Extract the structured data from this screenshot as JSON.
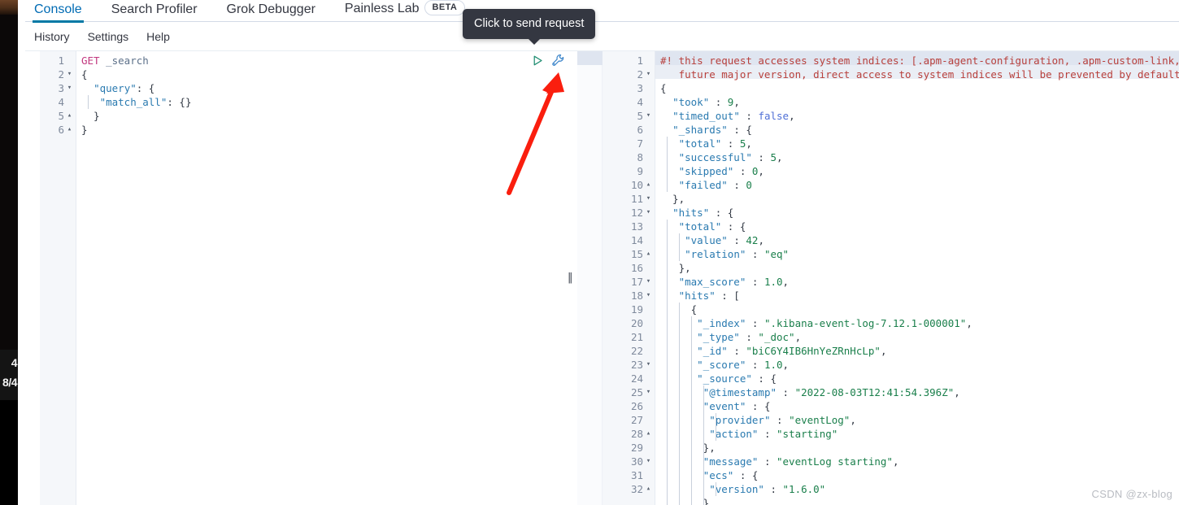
{
  "overlay": {
    "partial_line_1": "4",
    "partial_line_2": "8/4"
  },
  "tabs": [
    {
      "label": "Console",
      "active": true
    },
    {
      "label": "Search Profiler",
      "active": false
    },
    {
      "label": "Grok Debugger",
      "active": false
    },
    {
      "label": "Painless Lab",
      "active": false,
      "badge": "BETA"
    }
  ],
  "submenu": [
    {
      "label": "History"
    },
    {
      "label": "Settings"
    },
    {
      "label": "Help"
    }
  ],
  "tooltip": {
    "text": "Click to send request"
  },
  "actions": {
    "send_icon": "play-triangle-icon",
    "wrench_icon": "wrench-icon"
  },
  "divider": {
    "grip": "‖"
  },
  "request_editor": {
    "lines": [
      {
        "n": "1",
        "fold": "",
        "indent": 0,
        "tokens": [
          {
            "t": "GET",
            "c": "t-method"
          },
          {
            "t": " ",
            "c": "t-punc"
          },
          {
            "t": "_search",
            "c": "t-url"
          }
        ]
      },
      {
        "n": "2",
        "fold": "▾",
        "indent": 0,
        "tokens": [
          {
            "t": "{",
            "c": "t-punc"
          }
        ]
      },
      {
        "n": "3",
        "fold": "▾",
        "indent": 0,
        "tokens": [
          {
            "t": "  ",
            "c": "t-punc"
          },
          {
            "t": "\"query\"",
            "c": "t-key"
          },
          {
            "t": ": {",
            "c": "t-punc"
          }
        ]
      },
      {
        "n": "4",
        "fold": "",
        "indent": 1,
        "tokens": [
          {
            "t": "   ",
            "c": "t-punc"
          },
          {
            "t": "\"match_all\"",
            "c": "t-key"
          },
          {
            "t": ": {}",
            "c": "t-punc"
          }
        ]
      },
      {
        "n": "5",
        "fold": "▴",
        "indent": 0,
        "tokens": [
          {
            "t": "  }",
            "c": "t-punc"
          }
        ]
      },
      {
        "n": "6",
        "fold": "▴",
        "indent": 0,
        "tokens": [
          {
            "t": "}",
            "c": "t-punc"
          }
        ]
      }
    ]
  },
  "response_editor": {
    "lines": [
      {
        "n": "1",
        "fold": "",
        "indent": 0,
        "tokens": [
          {
            "t": "#! this request accesses system indices: [.apm-agent-configuration, .apm-custom-link, .k",
            "c": "t-warn"
          }
        ]
      },
      {
        "n": "",
        "fold": "",
        "indent": 0,
        "tokens": [
          {
            "t": "   future major version, direct access to system indices will be prevented by default",
            "c": "t-warn"
          }
        ]
      },
      {
        "n": "2",
        "fold": "▾",
        "indent": 0,
        "tokens": [
          {
            "t": "{",
            "c": "t-punc"
          }
        ]
      },
      {
        "n": "3",
        "fold": "",
        "indent": 0,
        "tokens": [
          {
            "t": "  ",
            "c": "t-punc"
          },
          {
            "t": "\"took\"",
            "c": "t-key"
          },
          {
            "t": " : ",
            "c": "t-punc"
          },
          {
            "t": "9",
            "c": "t-num"
          },
          {
            "t": ",",
            "c": "t-punc"
          }
        ]
      },
      {
        "n": "4",
        "fold": "",
        "indent": 0,
        "tokens": [
          {
            "t": "  ",
            "c": "t-punc"
          },
          {
            "t": "\"timed_out\"",
            "c": "t-key"
          },
          {
            "t": " : ",
            "c": "t-punc"
          },
          {
            "t": "false",
            "c": "t-bool"
          },
          {
            "t": ",",
            "c": "t-punc"
          }
        ]
      },
      {
        "n": "5",
        "fold": "▾",
        "indent": 0,
        "tokens": [
          {
            "t": "  ",
            "c": "t-punc"
          },
          {
            "t": "\"_shards\"",
            "c": "t-key"
          },
          {
            "t": " : {",
            "c": "t-punc"
          }
        ]
      },
      {
        "n": "6",
        "fold": "",
        "indent": 1,
        "tokens": [
          {
            "t": "   ",
            "c": "t-punc"
          },
          {
            "t": "\"total\"",
            "c": "t-key"
          },
          {
            "t": " : ",
            "c": "t-punc"
          },
          {
            "t": "5",
            "c": "t-num"
          },
          {
            "t": ",",
            "c": "t-punc"
          }
        ]
      },
      {
        "n": "7",
        "fold": "",
        "indent": 1,
        "tokens": [
          {
            "t": "   ",
            "c": "t-punc"
          },
          {
            "t": "\"successful\"",
            "c": "t-key"
          },
          {
            "t": " : ",
            "c": "t-punc"
          },
          {
            "t": "5",
            "c": "t-num"
          },
          {
            "t": ",",
            "c": "t-punc"
          }
        ]
      },
      {
        "n": "8",
        "fold": "",
        "indent": 1,
        "tokens": [
          {
            "t": "   ",
            "c": "t-punc"
          },
          {
            "t": "\"skipped\"",
            "c": "t-key"
          },
          {
            "t": " : ",
            "c": "t-punc"
          },
          {
            "t": "0",
            "c": "t-num"
          },
          {
            "t": ",",
            "c": "t-punc"
          }
        ]
      },
      {
        "n": "9",
        "fold": "",
        "indent": 1,
        "tokens": [
          {
            "t": "   ",
            "c": "t-punc"
          },
          {
            "t": "\"failed\"",
            "c": "t-key"
          },
          {
            "t": " : ",
            "c": "t-punc"
          },
          {
            "t": "0",
            "c": "t-num"
          }
        ]
      },
      {
        "n": "10",
        "fold": "▴",
        "indent": 0,
        "tokens": [
          {
            "t": "  },",
            "c": "t-punc"
          }
        ]
      },
      {
        "n": "11",
        "fold": "▾",
        "indent": 0,
        "tokens": [
          {
            "t": "  ",
            "c": "t-punc"
          },
          {
            "t": "\"hits\"",
            "c": "t-key"
          },
          {
            "t": " : {",
            "c": "t-punc"
          }
        ]
      },
      {
        "n": "12",
        "fold": "▾",
        "indent": 1,
        "tokens": [
          {
            "t": "   ",
            "c": "t-punc"
          },
          {
            "t": "\"total\"",
            "c": "t-key"
          },
          {
            "t": " : {",
            "c": "t-punc"
          }
        ]
      },
      {
        "n": "13",
        "fold": "",
        "indent": 2,
        "tokens": [
          {
            "t": "    ",
            "c": "t-punc"
          },
          {
            "t": "\"value\"",
            "c": "t-key"
          },
          {
            "t": " : ",
            "c": "t-punc"
          },
          {
            "t": "42",
            "c": "t-num"
          },
          {
            "t": ",",
            "c": "t-punc"
          }
        ]
      },
      {
        "n": "14",
        "fold": "",
        "indent": 2,
        "tokens": [
          {
            "t": "    ",
            "c": "t-punc"
          },
          {
            "t": "\"relation\"",
            "c": "t-key"
          },
          {
            "t": " : ",
            "c": "t-punc"
          },
          {
            "t": "\"eq\"",
            "c": "t-str"
          }
        ]
      },
      {
        "n": "15",
        "fold": "▴",
        "indent": 1,
        "tokens": [
          {
            "t": "   },",
            "c": "t-punc"
          }
        ]
      },
      {
        "n": "16",
        "fold": "",
        "indent": 1,
        "tokens": [
          {
            "t": "   ",
            "c": "t-punc"
          },
          {
            "t": "\"max_score\"",
            "c": "t-key"
          },
          {
            "t": " : ",
            "c": "t-punc"
          },
          {
            "t": "1.0",
            "c": "t-num"
          },
          {
            "t": ",",
            "c": "t-punc"
          }
        ]
      },
      {
        "n": "17",
        "fold": "▾",
        "indent": 1,
        "tokens": [
          {
            "t": "   ",
            "c": "t-punc"
          },
          {
            "t": "\"hits\"",
            "c": "t-key"
          },
          {
            "t": " : [",
            "c": "t-punc"
          }
        ]
      },
      {
        "n": "18",
        "fold": "▾",
        "indent": 2,
        "tokens": [
          {
            "t": "     {",
            "c": "t-punc"
          }
        ]
      },
      {
        "n": "19",
        "fold": "",
        "indent": 3,
        "tokens": [
          {
            "t": "      ",
            "c": "t-punc"
          },
          {
            "t": "\"_index\"",
            "c": "t-key"
          },
          {
            "t": " : ",
            "c": "t-punc"
          },
          {
            "t": "\".kibana-event-log-7.12.1-000001\"",
            "c": "t-str"
          },
          {
            "t": ",",
            "c": "t-punc"
          }
        ]
      },
      {
        "n": "20",
        "fold": "",
        "indent": 3,
        "tokens": [
          {
            "t": "      ",
            "c": "t-punc"
          },
          {
            "t": "\"_type\"",
            "c": "t-key"
          },
          {
            "t": " : ",
            "c": "t-punc"
          },
          {
            "t": "\"_doc\"",
            "c": "t-str"
          },
          {
            "t": ",",
            "c": "t-punc"
          }
        ]
      },
      {
        "n": "21",
        "fold": "",
        "indent": 3,
        "tokens": [
          {
            "t": "      ",
            "c": "t-punc"
          },
          {
            "t": "\"_id\"",
            "c": "t-key"
          },
          {
            "t": " : ",
            "c": "t-punc"
          },
          {
            "t": "\"biC6Y4IB6HnYeZRnHcLp\"",
            "c": "t-str"
          },
          {
            "t": ",",
            "c": "t-punc"
          }
        ]
      },
      {
        "n": "22",
        "fold": "",
        "indent": 3,
        "tokens": [
          {
            "t": "      ",
            "c": "t-punc"
          },
          {
            "t": "\"_score\"",
            "c": "t-key"
          },
          {
            "t": " : ",
            "c": "t-punc"
          },
          {
            "t": "1.0",
            "c": "t-num"
          },
          {
            "t": ",",
            "c": "t-punc"
          }
        ]
      },
      {
        "n": "23",
        "fold": "▾",
        "indent": 3,
        "tokens": [
          {
            "t": "      ",
            "c": "t-punc"
          },
          {
            "t": "\"_source\"",
            "c": "t-key"
          },
          {
            "t": " : {",
            "c": "t-punc"
          }
        ]
      },
      {
        "n": "24",
        "fold": "",
        "indent": 4,
        "tokens": [
          {
            "t": "       ",
            "c": "t-punc"
          },
          {
            "t": "\"@timestamp\"",
            "c": "t-key"
          },
          {
            "t": " : ",
            "c": "t-punc"
          },
          {
            "t": "\"2022-08-03T12:41:54.396Z\"",
            "c": "t-str"
          },
          {
            "t": ",",
            "c": "t-punc"
          }
        ]
      },
      {
        "n": "25",
        "fold": "▾",
        "indent": 4,
        "tokens": [
          {
            "t": "       ",
            "c": "t-punc"
          },
          {
            "t": "\"event\"",
            "c": "t-key"
          },
          {
            "t": " : {",
            "c": "t-punc"
          }
        ]
      },
      {
        "n": "26",
        "fold": "",
        "indent": 5,
        "tokens": [
          {
            "t": "        ",
            "c": "t-punc"
          },
          {
            "t": "\"provider\"",
            "c": "t-key"
          },
          {
            "t": " : ",
            "c": "t-punc"
          },
          {
            "t": "\"eventLog\"",
            "c": "t-str"
          },
          {
            "t": ",",
            "c": "t-punc"
          }
        ]
      },
      {
        "n": "27",
        "fold": "",
        "indent": 5,
        "tokens": [
          {
            "t": "        ",
            "c": "t-punc"
          },
          {
            "t": "\"action\"",
            "c": "t-key"
          },
          {
            "t": " : ",
            "c": "t-punc"
          },
          {
            "t": "\"starting\"",
            "c": "t-str"
          }
        ]
      },
      {
        "n": "28",
        "fold": "▴",
        "indent": 4,
        "tokens": [
          {
            "t": "       },",
            "c": "t-punc"
          }
        ]
      },
      {
        "n": "29",
        "fold": "",
        "indent": 4,
        "tokens": [
          {
            "t": "       ",
            "c": "t-punc"
          },
          {
            "t": "\"message\"",
            "c": "t-key"
          },
          {
            "t": " : ",
            "c": "t-punc"
          },
          {
            "t": "\"eventLog starting\"",
            "c": "t-str"
          },
          {
            "t": ",",
            "c": "t-punc"
          }
        ]
      },
      {
        "n": "30",
        "fold": "▾",
        "indent": 4,
        "tokens": [
          {
            "t": "       ",
            "c": "t-punc"
          },
          {
            "t": "\"ecs\"",
            "c": "t-key"
          },
          {
            "t": " : {",
            "c": "t-punc"
          }
        ]
      },
      {
        "n": "31",
        "fold": "",
        "indent": 5,
        "tokens": [
          {
            "t": "        ",
            "c": "t-punc"
          },
          {
            "t": "\"version\"",
            "c": "t-key"
          },
          {
            "t": " : ",
            "c": "t-punc"
          },
          {
            "t": "\"1.6.0\"",
            "c": "t-str"
          }
        ]
      },
      {
        "n": "32",
        "fold": "▴",
        "indent": 4,
        "tokens": [
          {
            "t": "       }",
            "c": "t-punc"
          }
        ]
      }
    ]
  },
  "watermark": {
    "text": "CSDN @zx-blog"
  },
  "colors": {
    "accent": "#0079a5",
    "tab_active_text": "#006bb4",
    "tooltip_bg": "#343741",
    "warning_text": "#b8403c",
    "arrow_red": "#fa1e0e",
    "string_green": "#1a7f4b",
    "key_blue": "#2a7ab0",
    "method_pink": "#c2387f"
  }
}
